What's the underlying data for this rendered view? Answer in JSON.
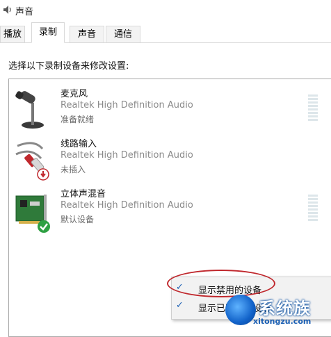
{
  "window": {
    "title": "声音"
  },
  "tabs": [
    {
      "label": "播放",
      "active": false
    },
    {
      "label": "录制",
      "active": true
    },
    {
      "label": "声音",
      "active": false
    },
    {
      "label": "通信",
      "active": false
    }
  ],
  "instruction": "选择以下录制设备来修改设置:",
  "devices": [
    {
      "name": "麦克风",
      "driver": "Realtek High Definition Audio",
      "status": "准备就绪",
      "icon": "microphone-icon"
    },
    {
      "name": "线路输入",
      "driver": "Realtek High Definition Audio",
      "status": "未插入",
      "icon": "line-in-cable-icon",
      "badge": "unplugged-badge"
    },
    {
      "name": "立体声混音",
      "driver": "Realtek High Definition Audio",
      "status": "默认设备",
      "icon": "sound-card-icon",
      "badge": "default-check-badge"
    }
  ],
  "context_menu": {
    "items": [
      {
        "label": "显示禁用的设备",
        "checked": true
      },
      {
        "label": "显示已断开的设备",
        "checked": true
      }
    ]
  },
  "watermark": {
    "text": "系统族",
    "url": "xitongzu.com"
  },
  "colors": {
    "highlight_circle": "#c0282d",
    "check": "#1a5fb4",
    "meter": "#dde6ea"
  }
}
